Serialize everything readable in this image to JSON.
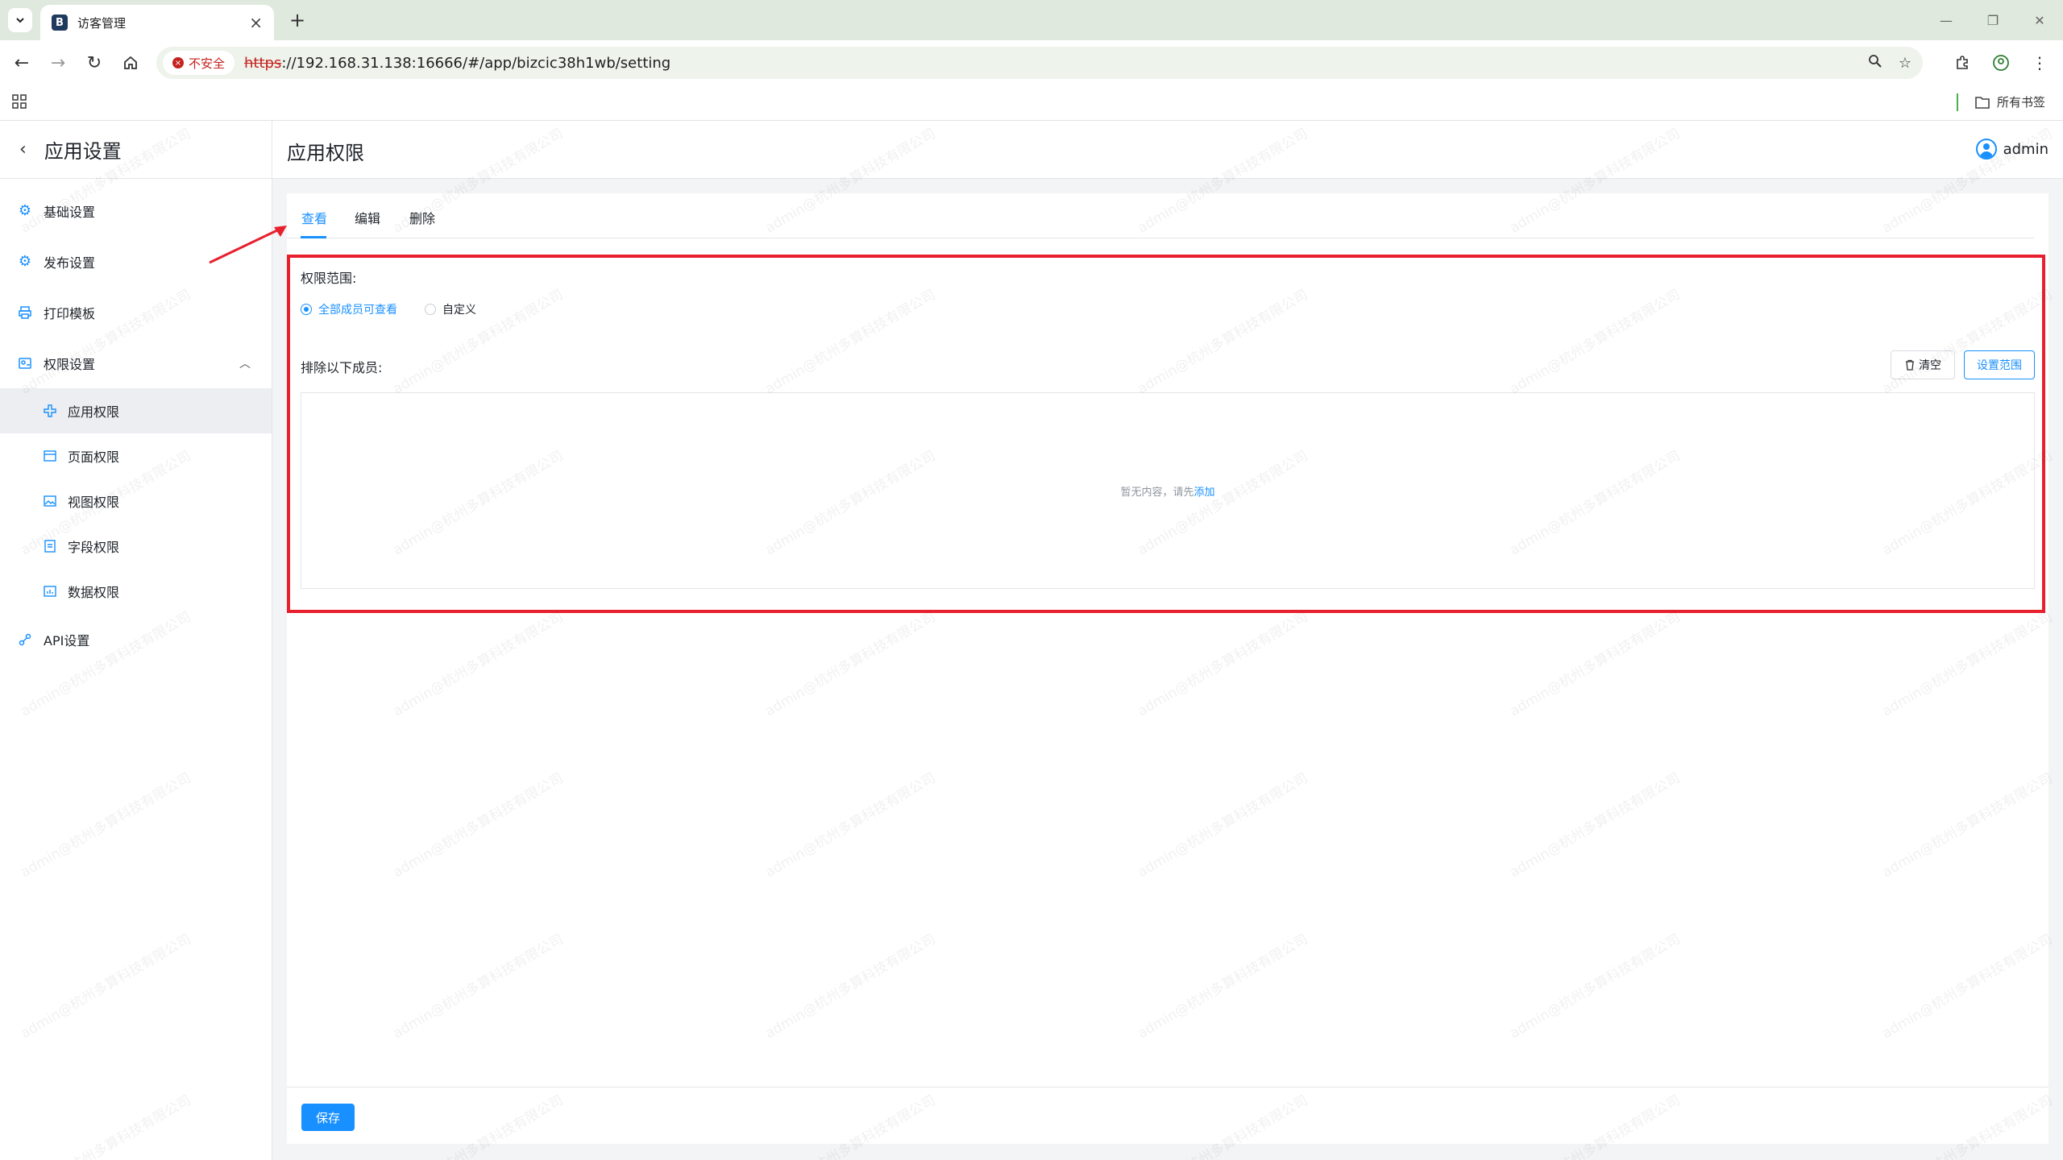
{
  "browser": {
    "tab_title": "访客管理",
    "tab_favicon": "B",
    "security_label": "不安全",
    "url_scheme": "https",
    "url_rest": "://192.168.31.138:16666/#/app/bizcic38h1wb/setting",
    "all_bookmarks": "所有书签"
  },
  "sidebar": {
    "title": "应用设置",
    "items": [
      {
        "label": "基础设置",
        "icon": "gear-icon"
      },
      {
        "label": "发布设置",
        "icon": "gear-icon"
      },
      {
        "label": "打印模板",
        "icon": "printer-icon"
      },
      {
        "label": "权限设置",
        "icon": "permission-icon"
      }
    ],
    "sub_items": [
      {
        "label": "应用权限",
        "icon": "app-icon",
        "active": true
      },
      {
        "label": "页面权限",
        "icon": "page-icon"
      },
      {
        "label": "视图权限",
        "icon": "image-icon"
      },
      {
        "label": "字段权限",
        "icon": "field-icon"
      },
      {
        "label": "数据权限",
        "icon": "data-icon"
      }
    ],
    "api": {
      "label": "API设置",
      "icon": "link-icon"
    }
  },
  "header": {
    "page_title": "应用权限",
    "user": "admin"
  },
  "perm_tabs": [
    {
      "label": "查看",
      "active": true
    },
    {
      "label": "编辑"
    },
    {
      "label": "删除"
    }
  ],
  "scope": {
    "label": "权限范围:",
    "options": [
      {
        "label": "全部成员可查看",
        "checked": true
      },
      {
        "label": "自定义",
        "checked": false
      }
    ]
  },
  "exclude": {
    "label": "排除以下成员:",
    "clear_button": "清空",
    "set_scope_button": "设置范围",
    "empty_text": "暂无内容，请先",
    "empty_link": "添加"
  },
  "save_button": "保存",
  "watermark": "admin@杭州多算科技有限公司",
  "colors": {
    "primary": "#1890ff",
    "annotation_red": "#e8202e"
  }
}
